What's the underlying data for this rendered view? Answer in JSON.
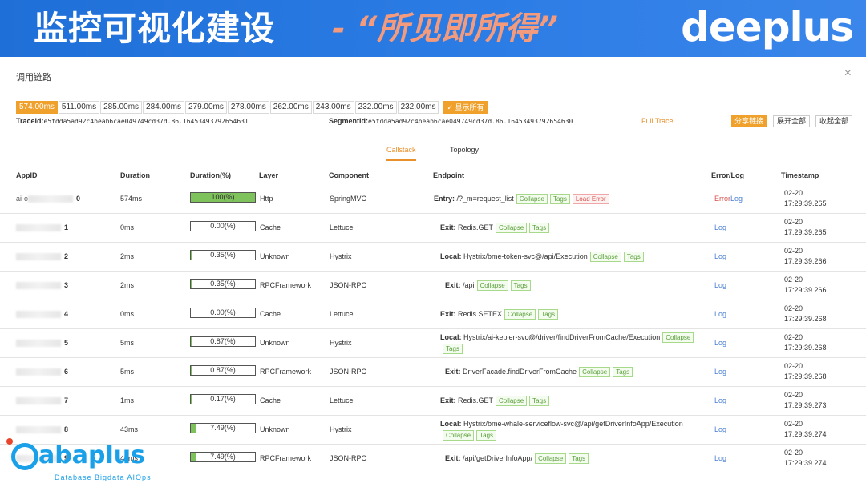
{
  "banner": {
    "title": "监控可视化建设",
    "subtitle": "- “所见即所得”",
    "logo": "deeplus"
  },
  "panel": {
    "title": "调用链路",
    "close": "×",
    "durations": [
      "574.00ms",
      "511.00ms",
      "285.00ms",
      "284.00ms",
      "279.00ms",
      "278.00ms",
      "262.00ms",
      "243.00ms",
      "232.00ms",
      "232.00ms"
    ],
    "show_all": "✓ 显示所有",
    "trace_label": "TraceId:",
    "trace_value": "e5fdda5ad92c4beab6cae049749cd37d.86.16453493792654631",
    "segment_label": "SegmentId:",
    "segment_value": "e5fdda5ad92c4beab6cae049749cd37d.86.16453493792654630",
    "full_trace": "Full Trace",
    "share": "分享链接",
    "expand_all": "展开全部",
    "collapse_all": "收起全部",
    "tab_callstack": "Callstack",
    "tab_topology": "Topology"
  },
  "table": {
    "headers": {
      "appid": "AppID",
      "duration": "Duration",
      "duration_pct": "Duration(%)",
      "layer": "Layer",
      "component": "Component",
      "endpoint": "Endpoint",
      "errorlog": "Error/Log",
      "timestamp": "Timestamp"
    },
    "rows": [
      {
        "appid_pre": "ai-o",
        "appid_num": "0",
        "duration": "574ms",
        "pct": "100(%)",
        "pct_val": 100,
        "layer": "Http",
        "component": "SpringMVC",
        "ep_kind": "Entry:",
        "ep_path": " /?_m=request_list",
        "collapse": "Collapse",
        "tags": "Tags",
        "load_error": "Load Error",
        "error": "Error",
        "log": "Log",
        "ts_date": "02-20",
        "ts_time": "17:29:39.265"
      },
      {
        "appid_pre": "",
        "appid_num": "1",
        "duration": "0ms",
        "pct": "0.00(%)",
        "pct_val": 0,
        "layer": "Cache",
        "component": "Lettuce",
        "ep_kind": "Exit:",
        "ep_path": " Redis.GET",
        "collapse": "Collapse",
        "tags": "Tags",
        "log": "Log",
        "ts_date": "02-20",
        "ts_time": "17:29:39.265"
      },
      {
        "appid_pre": "",
        "appid_num": "2",
        "duration": "2ms",
        "pct": "0.35(%)",
        "pct_val": 0.35,
        "layer": "Unknown",
        "component": "Hystrix",
        "ep_kind": "Local:",
        "ep_path": " Hystrix/bme-token-svc@/api/Execution",
        "collapse": "Collapse",
        "tags": "Tags",
        "log": "Log",
        "ts_date": "02-20",
        "ts_time": "17:29:39.266"
      },
      {
        "appid_pre": "",
        "appid_num": "3",
        "duration": "2ms",
        "pct": "0.35(%)",
        "pct_val": 0.35,
        "layer": "RPCFramework",
        "component": "JSON-RPC",
        "ep_kind": "Exit:",
        "ep_path": " /api",
        "collapse": "Collapse",
        "tags": "Tags",
        "log": "Log",
        "ts_date": "02-20",
        "ts_time": "17:29:39.266"
      },
      {
        "appid_pre": "",
        "appid_num": "4",
        "duration": "0ms",
        "pct": "0.00(%)",
        "pct_val": 0,
        "layer": "Cache",
        "component": "Lettuce",
        "ep_kind": "Exit:",
        "ep_path": " Redis.SETEX",
        "collapse": "Collapse",
        "tags": "Tags",
        "log": "Log",
        "ts_date": "02-20",
        "ts_time": "17:29:39.268"
      },
      {
        "appid_pre": "",
        "appid_num": "5",
        "duration": "5ms",
        "pct": "0.87(%)",
        "pct_val": 0.87,
        "layer": "Unknown",
        "component": "Hystrix",
        "ep_kind": "Local:",
        "ep_path": " Hystrix/ai-kepler-svc@/driver/findDriverFromCache/Execution",
        "collapse": "Collapse",
        "tags": "Tags",
        "log": "Log",
        "ts_date": "02-20",
        "ts_time": "17:29:39.268"
      },
      {
        "appid_pre": "",
        "appid_num": "6",
        "duration": "5ms",
        "pct": "0.87(%)",
        "pct_val": 0.87,
        "layer": "RPCFramework",
        "component": "JSON-RPC",
        "ep_kind": "Exit:",
        "ep_path": " DriverFacade.findDriverFromCache",
        "collapse": "Collapse",
        "tags": "Tags",
        "log": "Log",
        "ts_date": "02-20",
        "ts_time": "17:29:39.268"
      },
      {
        "appid_pre": "",
        "appid_num": "7",
        "duration": "1ms",
        "pct": "0.17(%)",
        "pct_val": 0.17,
        "layer": "Cache",
        "component": "Lettuce",
        "ep_kind": "Exit:",
        "ep_path": " Redis.GET",
        "collapse": "Collapse",
        "tags": "Tags",
        "log": "Log",
        "ts_date": "02-20",
        "ts_time": "17:29:39.273"
      },
      {
        "appid_pre": "",
        "appid_num": "8",
        "duration": "43ms",
        "pct": "7.49(%)",
        "pct_val": 7.49,
        "layer": "Unknown",
        "component": "Hystrix",
        "ep_kind": "Local:",
        "ep_path": " Hystrix/bme-whale-serviceflow-svc@/api/getDriverInfoApp/Execution",
        "collapse": "Collapse",
        "tags": "Tags",
        "log": "Log",
        "ts_date": "02-20",
        "ts_time": "17:29:39.274"
      },
      {
        "appid_pre": "",
        "appid_num": "9",
        "duration": "43ms",
        "pct": "7.49(%)",
        "pct_val": 7.49,
        "layer": "RPCFramework",
        "component": "JSON-RPC",
        "ep_kind": "Exit:",
        "ep_path": " /api/getDriverInfoApp/",
        "collapse": "Collapse",
        "tags": "Tags",
        "log": "Log",
        "ts_date": "02-20",
        "ts_time": "17:29:39.274"
      }
    ]
  },
  "footer_logo": {
    "name": "abaplus",
    "tagline": "Database  Bigdata  AIOps"
  },
  "colors": {
    "banner": "#2d7de6",
    "accent": "#f0a12c",
    "bar_fill": "#7dc25a",
    "error": "#d9534f",
    "link": "#4a7fd4"
  }
}
